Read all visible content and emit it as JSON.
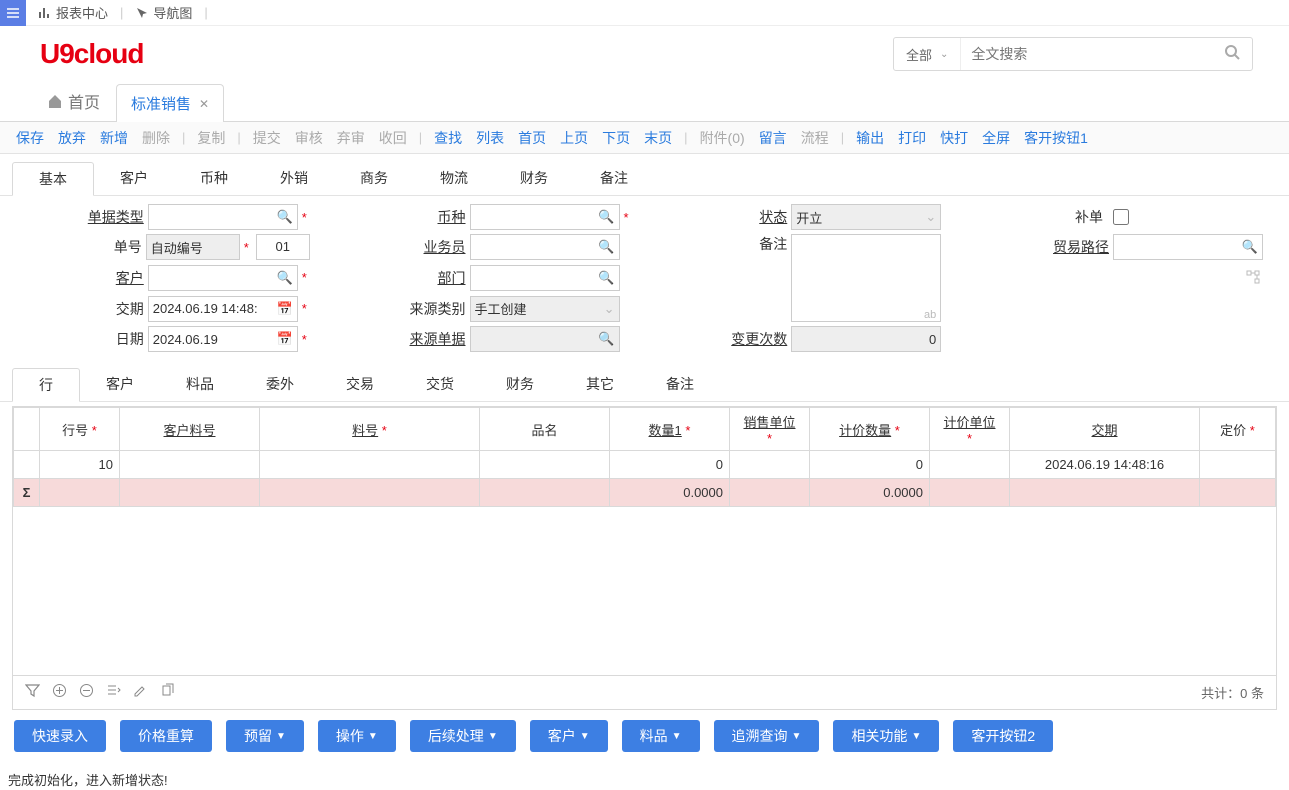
{
  "topbar": {
    "report_center": "报表中心",
    "nav_map": "导航图"
  },
  "brand": "U9cloud",
  "search": {
    "scope": "全部",
    "placeholder": "全文搜索"
  },
  "pagetabs": {
    "home": "首页",
    "current": "标准销售"
  },
  "toolbar": {
    "save": "保存",
    "discard": "放弃",
    "new": "新增",
    "delete": "删除",
    "copy": "复制",
    "submit": "提交",
    "approve": "审核",
    "unapprove": "弃审",
    "recall": "收回",
    "find": "查找",
    "list": "列表",
    "first": "首页",
    "prev": "上页",
    "next": "下页",
    "last": "末页",
    "attach": "附件(0)",
    "msg": "留言",
    "flow": "流程",
    "export": "输出",
    "print": "打印",
    "quickprint": "快打",
    "full": "全屏",
    "custom1": "客开按钮1"
  },
  "formtabs": [
    "基本",
    "客户",
    "币种",
    "外销",
    "商务",
    "物流",
    "财务",
    "备注"
  ],
  "form": {
    "doc_type_lbl": "单据类型",
    "doc_type": "",
    "currency_lbl": "币种",
    "currency": "",
    "status_lbl": "状态",
    "status": "开立",
    "supplement_lbl": "补单",
    "doc_no_lbl": "单号",
    "doc_no": "自动编号",
    "doc_seq": "01",
    "salesman_lbl": "业务员",
    "salesman": "",
    "remark_lbl": "备注",
    "trade_route_lbl": "贸易路径",
    "trade_route": "",
    "customer_lbl": "客户",
    "customer": "",
    "dept_lbl": "部门",
    "dept": "",
    "deliver_lbl": "交期",
    "deliver": "2024.06.19 14:48:",
    "src_type_lbl": "来源类别",
    "src_type": "手工创建",
    "date_lbl": "日期",
    "date": "2024.06.19",
    "src_doc_lbl": "来源单据",
    "src_doc": "",
    "change_cnt_lbl": "变更次数",
    "change_cnt": "0"
  },
  "detailtabs": [
    "行",
    "客户",
    "料品",
    "委外",
    "交易",
    "交货",
    "财务",
    "其它",
    "备注"
  ],
  "grid": {
    "cols": {
      "rownum": "行号",
      "cust_item": "客户料号",
      "item": "料号",
      "name": "品名",
      "qty1": "数量1",
      "sale_unit": "销售单位",
      "price_qty": "计价数量",
      "price_unit": "计价单位",
      "deliver": "交期",
      "price": "定价"
    },
    "row": {
      "rownum": "10",
      "qty1": "0",
      "price_qty": "0",
      "deliver": "2024.06.19 14:48:16"
    },
    "sum": {
      "qty1": "0.0000",
      "price_qty": "0.0000"
    },
    "count": "共计：0 条"
  },
  "actions": {
    "quick": "快速录入",
    "reprice": "价格重算",
    "reserve": "预留",
    "op": "操作",
    "post": "后续处理",
    "cust": "客户",
    "item": "料品",
    "trace": "追溯查询",
    "related": "相关功能",
    "custom2": "客开按钮2"
  },
  "status": "完成初始化，进入新增状态!"
}
